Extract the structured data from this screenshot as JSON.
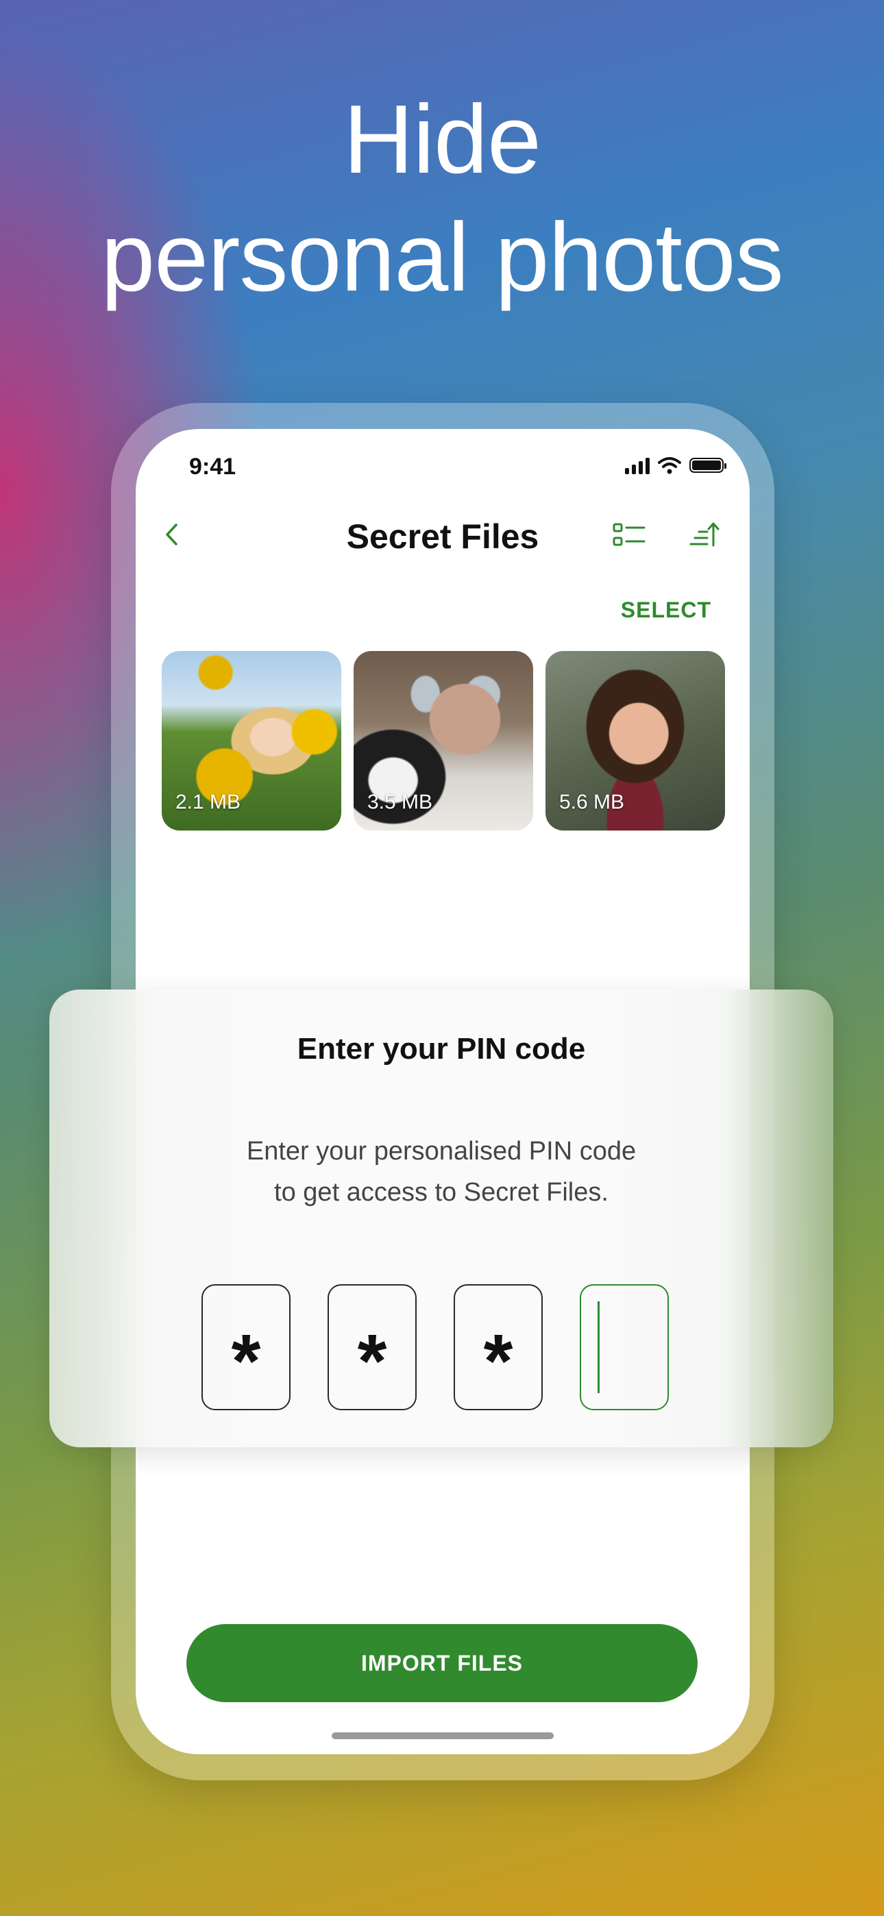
{
  "headline": {
    "line1": "Hide",
    "line2": "personal photos"
  },
  "status_bar": {
    "time": "9:41"
  },
  "nav": {
    "title": "Secret Files",
    "select": "SELECT"
  },
  "files": [
    {
      "size": "2.1 MB"
    },
    {
      "size": "3.5 MB"
    },
    {
      "size": "5.6 MB"
    }
  ],
  "pin": {
    "title": "Enter your PIN code",
    "desc_line1": "Enter your personalised PIN code",
    "desc_line2": "to get access to Secret Files.",
    "digits": [
      "*",
      "*",
      "*",
      ""
    ]
  },
  "import_button": "IMPORT FILES",
  "colors": {
    "accent": "#328a2f",
    "accent_text": "#2e8a2e"
  },
  "icons": [
    "back-chevron-icon",
    "list-view-icon",
    "sort-icon",
    "signal-icon",
    "wifi-icon",
    "battery-icon"
  ]
}
